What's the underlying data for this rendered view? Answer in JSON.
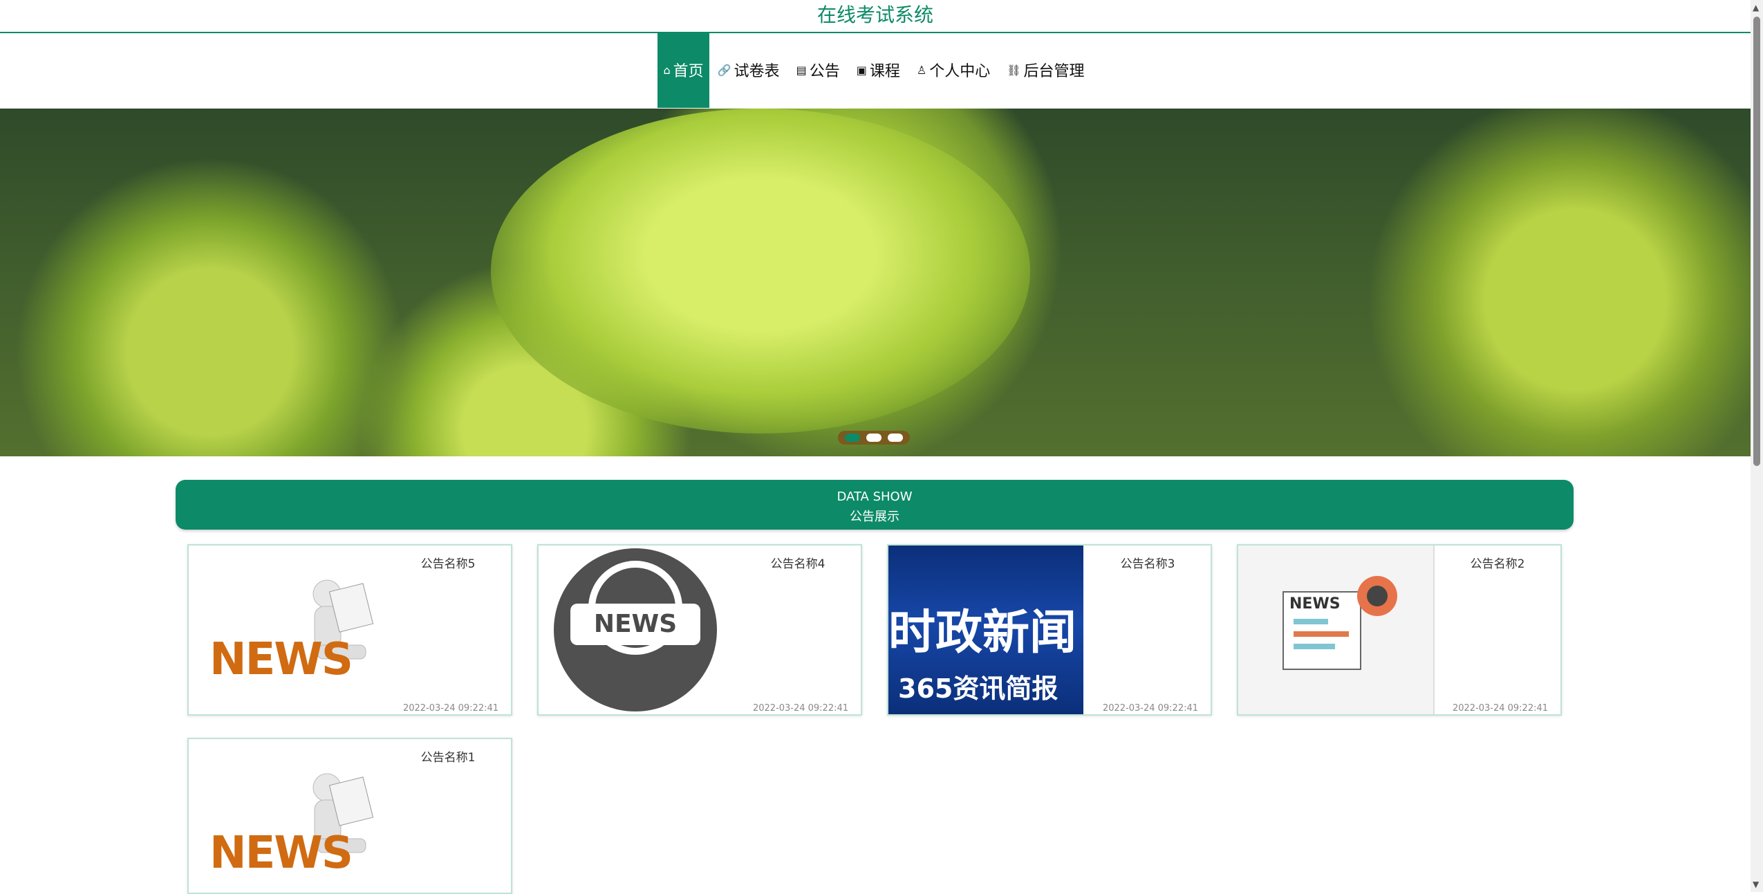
{
  "app": {
    "title": "在线考试系统"
  },
  "nav": {
    "items": [
      {
        "label": "首页",
        "icon": "⌂"
      },
      {
        "label": "试卷表",
        "icon": "🔗"
      },
      {
        "label": "公告",
        "icon": "▤"
      },
      {
        "label": "课程",
        "icon": "▣"
      },
      {
        "label": "个人中心",
        "icon": "♙"
      },
      {
        "label": "后台管理",
        "icon": "⛓"
      }
    ]
  },
  "banner": {
    "slides": 3,
    "active_slide": 1
  },
  "section": {
    "en": "DATA SHOW",
    "zh": "公告展示"
  },
  "cards": [
    {
      "name": "公告名称5",
      "time": "2022-03-24 09:22:41"
    },
    {
      "name": "公告名称4",
      "time": "2022-03-24 09:22:41",
      "thumb_text": "NEWS"
    },
    {
      "name": "公告名称3",
      "time": "2022-03-24 09:22:41",
      "thumb_line1": "时政新闻",
      "thumb_line2": "365资讯简报"
    },
    {
      "name": "公告名称2",
      "time": "2022-03-24 09:22:41",
      "thumb_text": "NEWS"
    },
    {
      "name": "公告名称1",
      "time": ""
    }
  ],
  "thumb_news3d_text": "NEWS",
  "colors": {
    "primary": "#0d8a67",
    "card_border": "#bfe3d4"
  }
}
